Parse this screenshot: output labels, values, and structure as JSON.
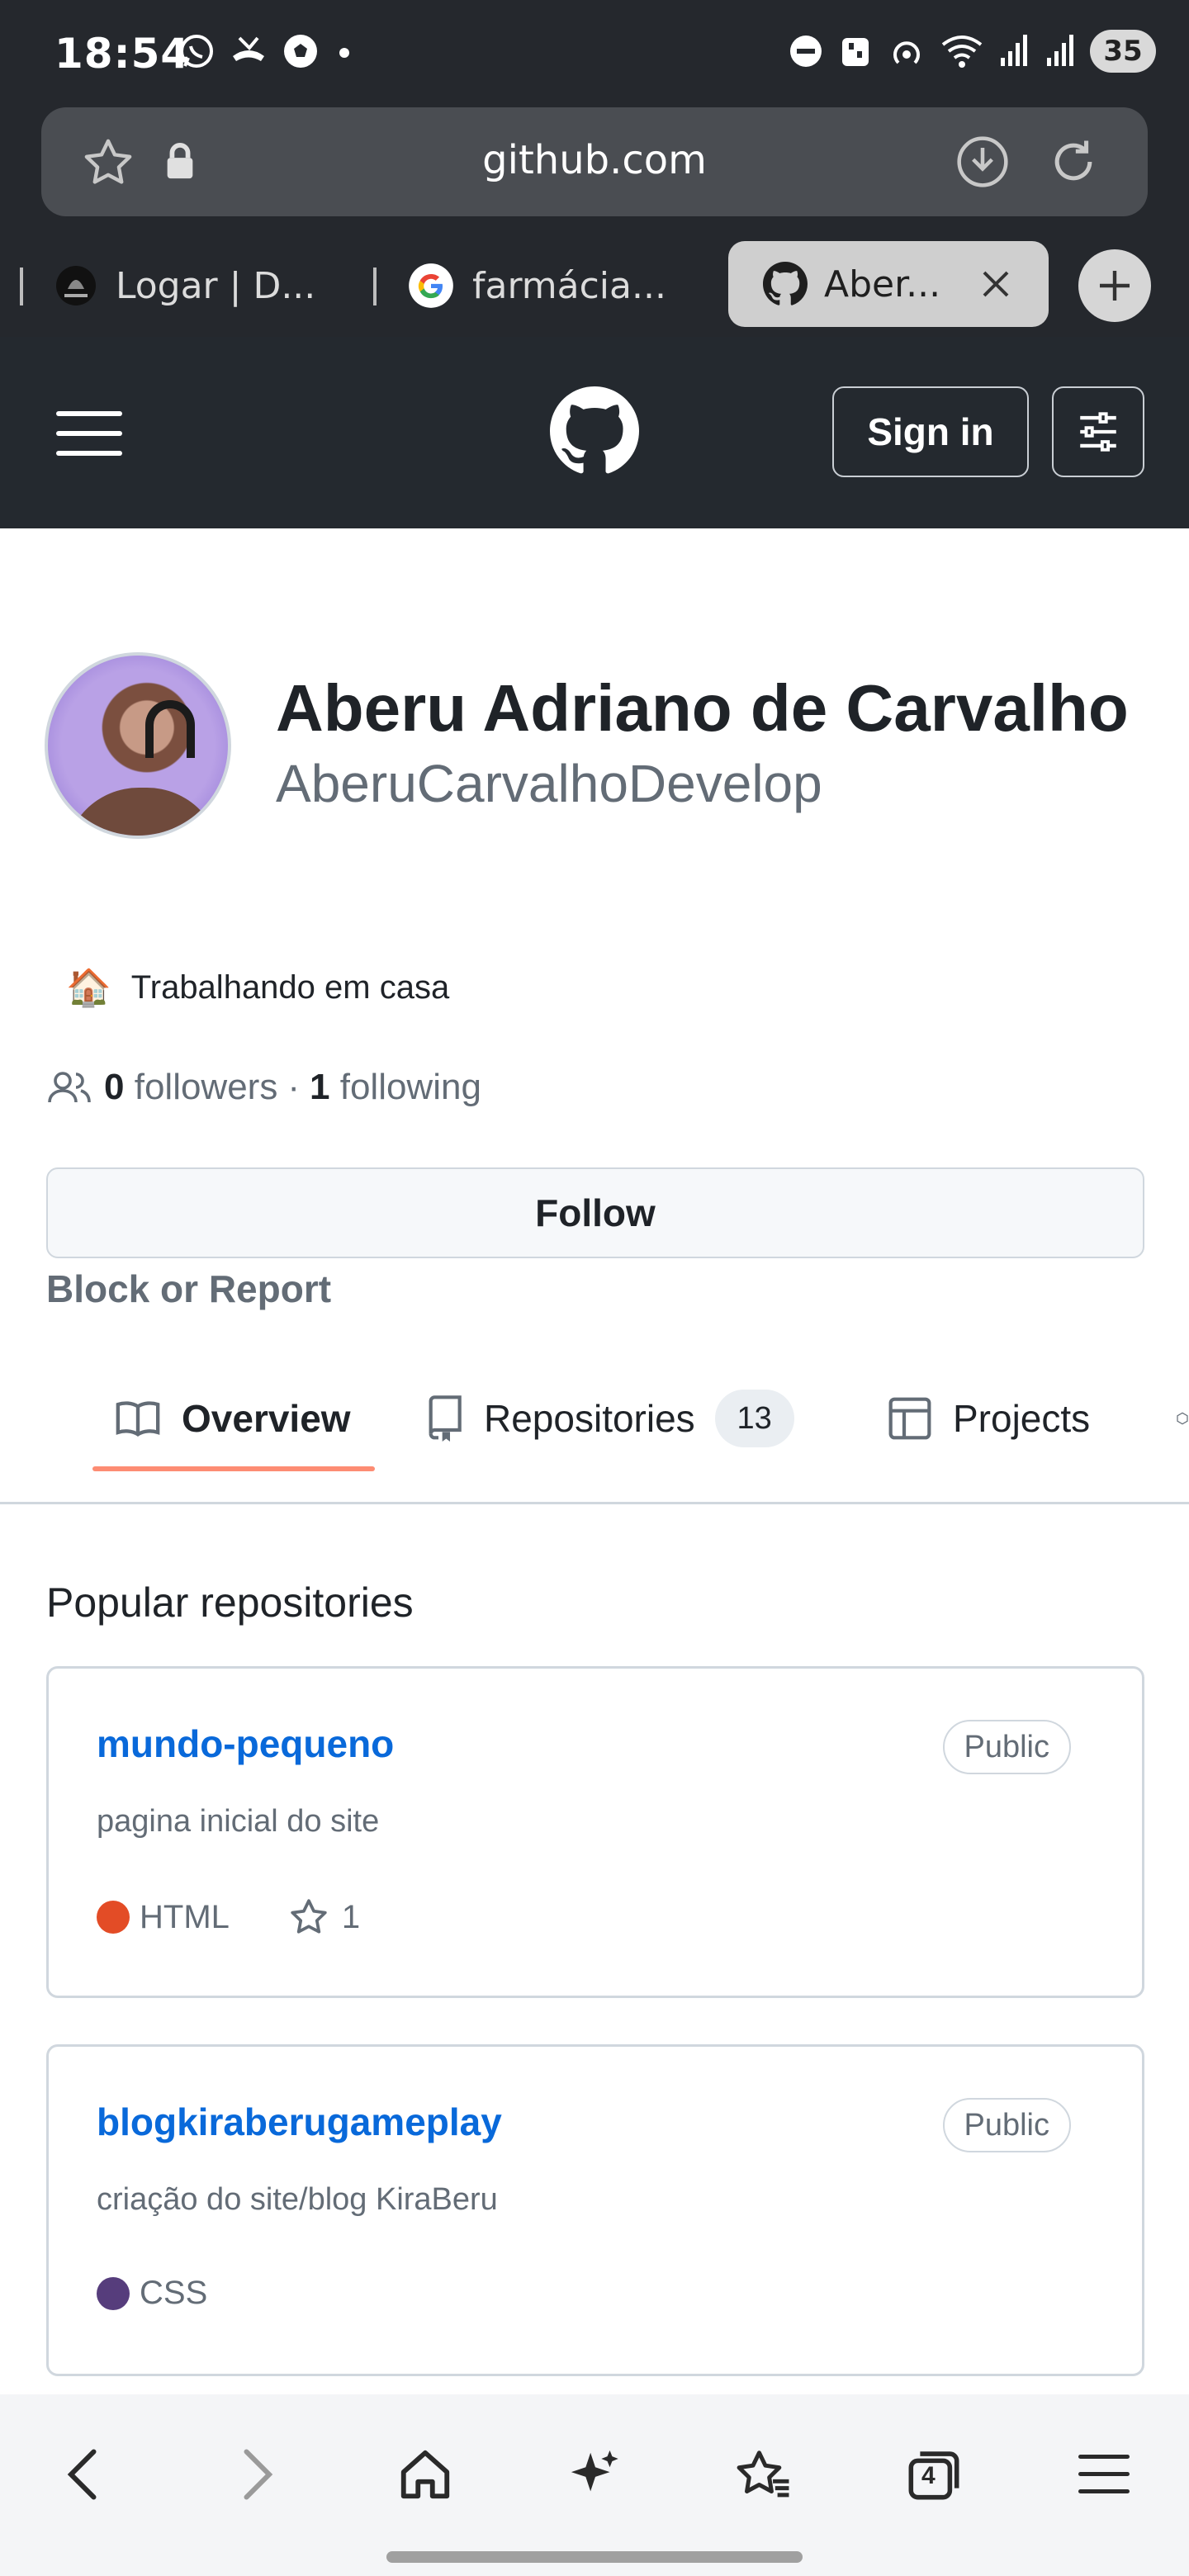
{
  "status_bar": {
    "time": "18:54",
    "battery": "35"
  },
  "browser": {
    "url": "github.com",
    "tabs": [
      {
        "label": "Logar | D..."
      },
      {
        "label": "farmácia..."
      },
      {
        "label": "Aber..."
      }
    ],
    "tab_count": "4"
  },
  "header": {
    "sign_in_label": "Sign in"
  },
  "profile": {
    "name": "Aberu Adriano de Carvalho",
    "login": "AberuCarvalhoDevelop",
    "status_emoji": "🏠",
    "status_text": "Trabalhando em casa",
    "followers_count": "0",
    "followers_label": "followers",
    "separator": "·",
    "following_count": "1",
    "following_label": "following",
    "follow_button": "Follow",
    "block_report": "Block or Report"
  },
  "nav": {
    "overview": "Overview",
    "repositories": "Repositories",
    "repositories_count": "13",
    "projects": "Projects"
  },
  "popular": {
    "title": "Popular repositories",
    "repos": [
      {
        "name": "mundo-pequeno",
        "visibility": "Public",
        "description": "pagina inicial do site",
        "language": "HTML",
        "language_color": "#e34c26",
        "stars": "1"
      },
      {
        "name": "blogkiraberugameplay",
        "visibility": "Public",
        "description": "criação do site/blog KiraBeru",
        "language": "CSS",
        "language_color": "#563d7c"
      }
    ]
  }
}
